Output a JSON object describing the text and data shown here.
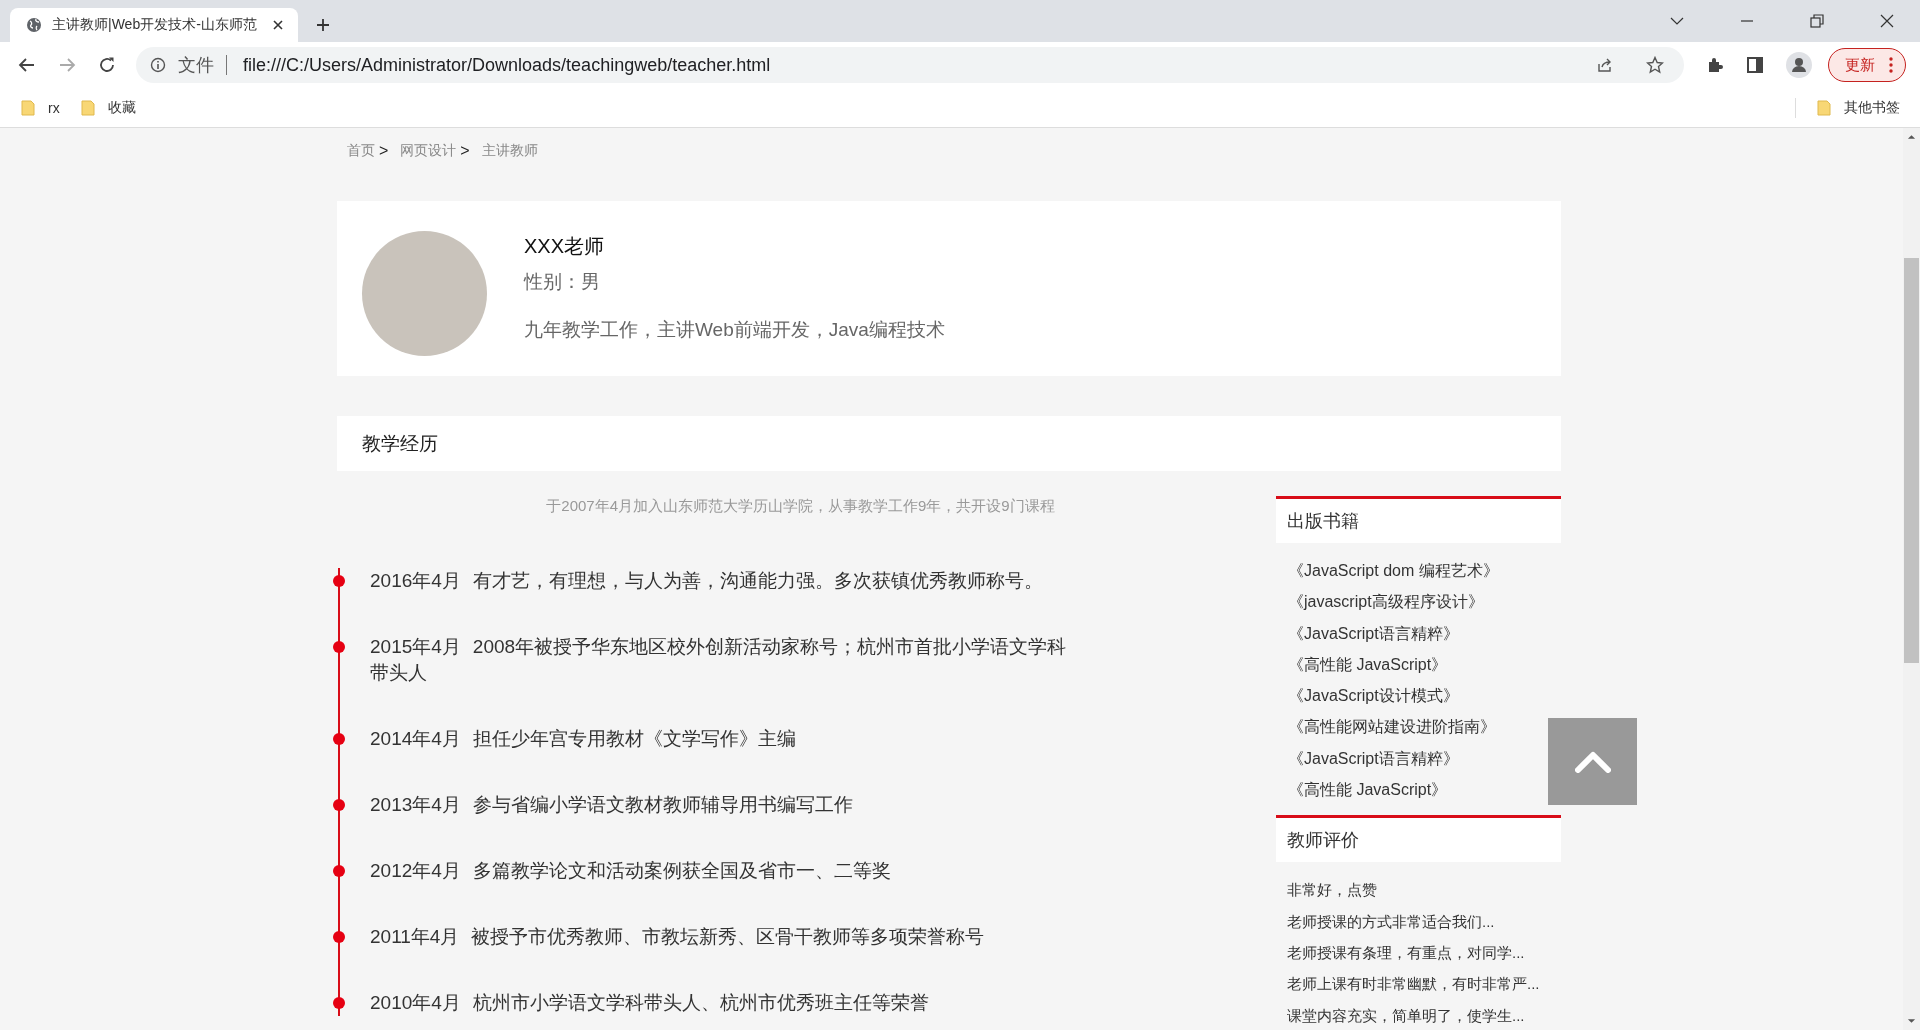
{
  "browser": {
    "tab_title": "主讲教师|Web开发技术-山东师范",
    "address_prefix": "文件",
    "url": "file:///C:/Users/Administrator/Downloads/teachingweb/teacher.html",
    "update_button": "更新",
    "bookmarks": [
      "rx",
      "收藏"
    ],
    "other_bookmarks": "其他书签"
  },
  "breadcrumb": [
    {
      "label": "首页",
      "separator": ">"
    },
    {
      "label": "网页设计",
      "separator": ">"
    },
    {
      "label": "主讲教师"
    }
  ],
  "profile": {
    "name": "XXX老师",
    "gender": "性别：男",
    "summary": "九年教学工作，主讲Web前端开发，Java编程技术"
  },
  "section_title": "教学经历",
  "intro": "于2007年4月加入山东师范大学历山学院，从事教学工作9年，共开设9门课程",
  "timeline": [
    {
      "date": "2016年4月",
      "text": "有才艺，有理想，与人为善，沟通能力强。多次获镇优秀教师称号。"
    },
    {
      "date": "2015年4月",
      "text": "2008年被授予华东地区校外创新活动家称号；杭州市首批小学语文学科带头人"
    },
    {
      "date": "2014年4月",
      "text": "担任少年宫专用教材《文学写作》主编"
    },
    {
      "date": "2013年4月",
      "text": "参与省编小学语文教材教师辅导用书编写工作"
    },
    {
      "date": "2012年4月",
      "text": "多篇教学论文和活动案例获全国及省市一、二等奖"
    },
    {
      "date": "2011年4月",
      "text": "被授予市优秀教师、市教坛新秀、区骨干教师等多项荣誉称号"
    },
    {
      "date": "2010年4月",
      "text": "杭州市小学语文学科带头人、杭州市优秀班主任等荣誉"
    }
  ],
  "books": {
    "title": "出版书籍",
    "items": [
      "《JavaScript dom 编程艺术》",
      "《javascript高级程序设计》",
      "《JavaScript语言精粹》",
      "《高性能 JavaScript》",
      "《JavaScript设计模式》",
      "《高性能网站建设进阶指南》",
      "《JavaScript语言精粹》",
      "《高性能 JavaScript》"
    ]
  },
  "reviews": {
    "title": "教师评价",
    "items": [
      "非常好，点赞",
      "老师授课的方式非常适合我们...",
      "老师授课有条理，有重点，对同学...",
      "老师上课有时非常幽默，有时非常严...",
      "课堂内容充实，简单明了，使学生..."
    ]
  }
}
